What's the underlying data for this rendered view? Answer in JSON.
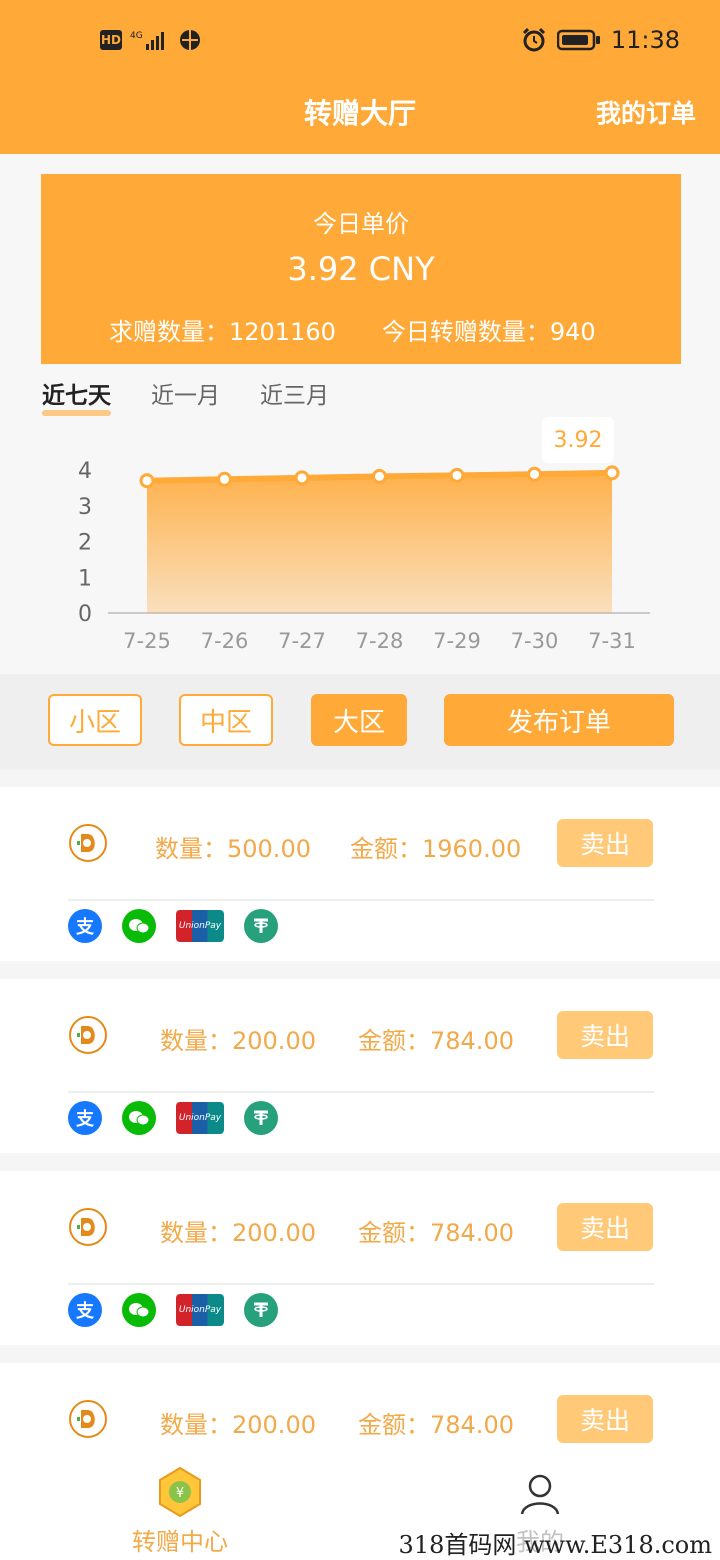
{
  "status_bar": {
    "hd": "HD",
    "net": "4G",
    "time": "11:38"
  },
  "header": {
    "title": "转赠大厅",
    "my_orders": "我的订单"
  },
  "price_card": {
    "label": "今日单价",
    "price": "3.92 CNY",
    "demand_label": "求赠数量：",
    "demand_value": "1201160",
    "today_label": "今日转赠数量：",
    "today_value": "940"
  },
  "range_tabs": [
    "近七天",
    "近一月",
    "近三月"
  ],
  "chart_data": {
    "type": "area",
    "categories": [
      "7-25",
      "7-26",
      "7-27",
      "7-28",
      "7-29",
      "7-30",
      "7-31"
    ],
    "values": [
      3.7,
      3.74,
      3.78,
      3.82,
      3.85,
      3.88,
      3.92
    ],
    "yticks": [
      "0",
      "1",
      "2",
      "3",
      "4"
    ],
    "ylim": [
      0,
      4
    ],
    "highlight_label": "3.92",
    "color": "#ffa938"
  },
  "filters": {
    "small": "小区",
    "medium": "中区",
    "large": "大区",
    "publish": "发布订单"
  },
  "orders": [
    {
      "qty_label": "数量：",
      "qty": "500.00",
      "amt_label": "金额：",
      "amt": "1960.00",
      "action": "卖出"
    },
    {
      "qty_label": "数量：",
      "qty": "200.00",
      "amt_label": "金额：",
      "amt": "784.00",
      "action": "卖出"
    },
    {
      "qty_label": "数量：",
      "qty": "200.00",
      "amt_label": "金额：",
      "amt": "784.00",
      "action": "卖出"
    },
    {
      "qty_label": "数量：",
      "qty": "200.00",
      "amt_label": "金额：",
      "amt": "784.00",
      "action": "卖出"
    }
  ],
  "payment_icons": [
    "alipay-icon",
    "wechat-pay-icon",
    "unionpay-icon",
    "tether-icon"
  ],
  "tabbar": {
    "home": "转赠中心",
    "me": "我的"
  },
  "watermark": "318首码网 www.E318.com"
}
